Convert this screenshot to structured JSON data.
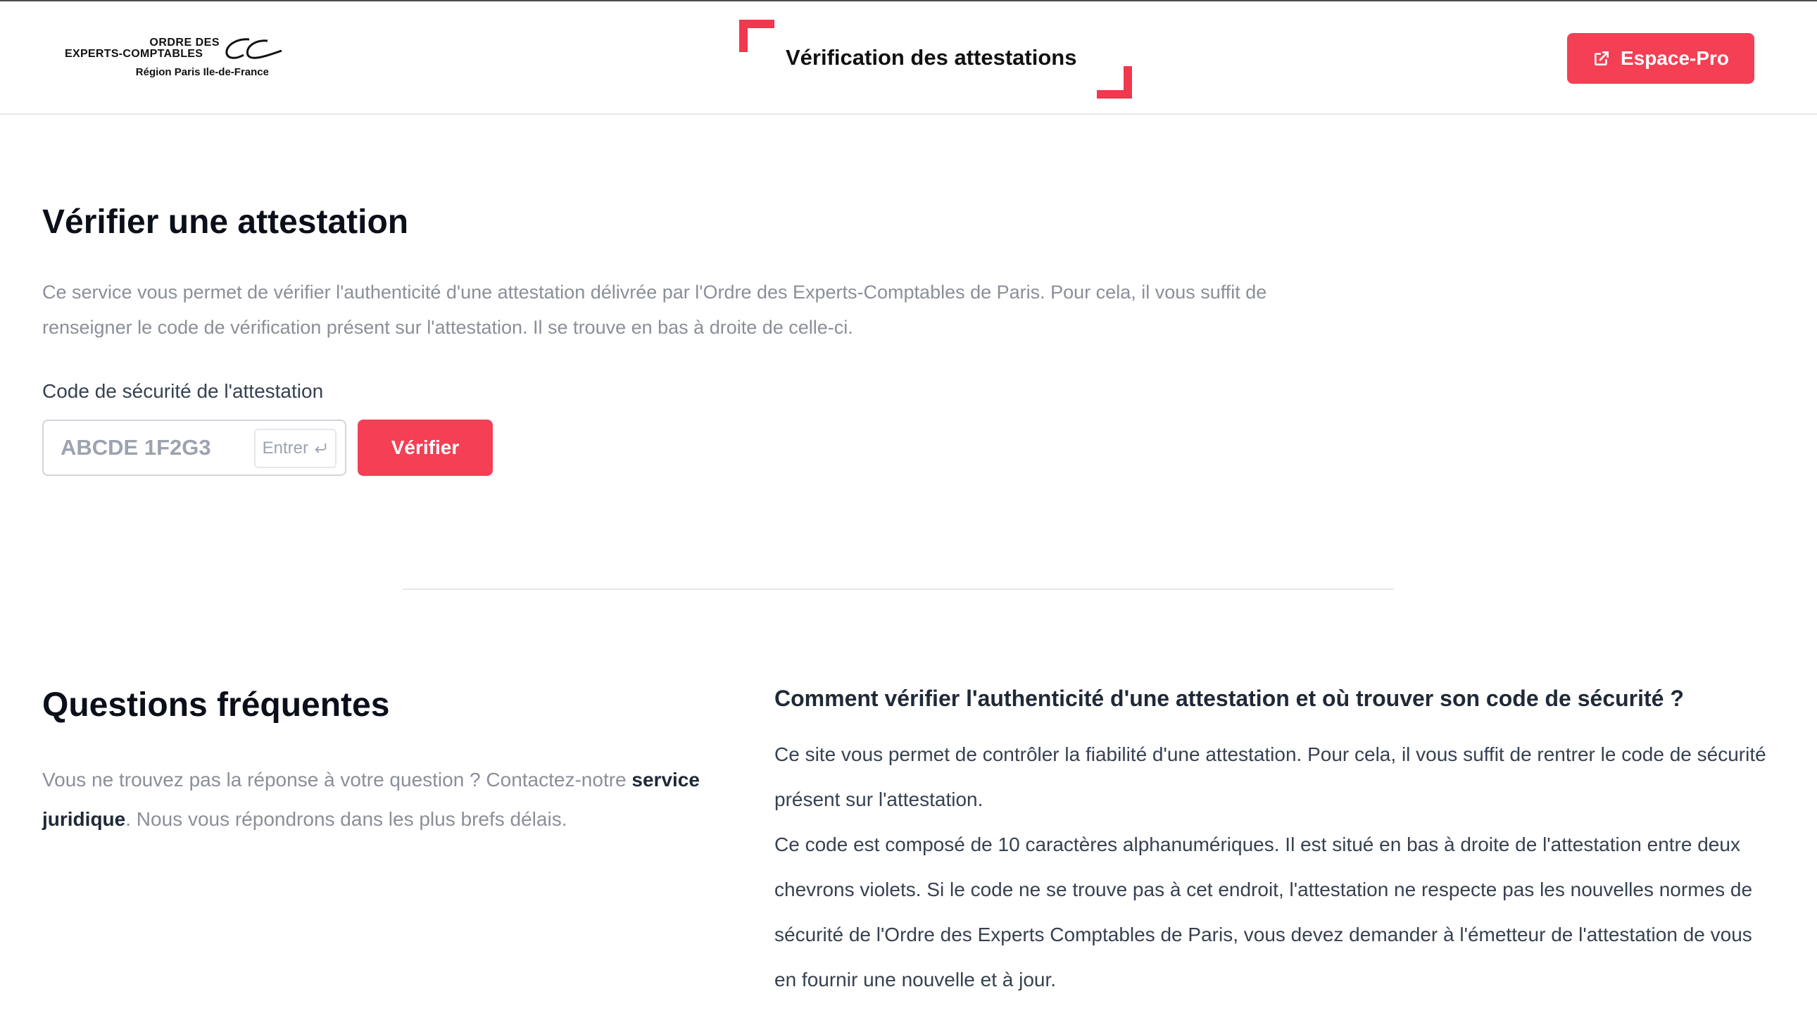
{
  "header": {
    "logo": {
      "line1": "ORDRE DES",
      "line2": "EXPERTS-COMPTABLES",
      "line3": "Région Paris Ile-de-France"
    },
    "title": "Vérification des attestations",
    "espace_pro_label": "Espace-Pro",
    "accent_color": "#f43f54"
  },
  "verify": {
    "title": "Vérifier une attestation",
    "description": "Ce service vous permet de vérifier l'authenticité d'une attestation délivrée par l'Ordre des Experts-Comptables de Paris. Pour cela, il vous suffit de renseigner le code de vérification présent sur l'attestation. Il se trouve en bas à droite de celle-ci.",
    "field_label": "Code de sécurité de l'attestation",
    "input_placeholder": "ABCDE 1F2G3",
    "input_value": "",
    "enter_hint": "Entrer",
    "button_label": "Vérifier"
  },
  "faq": {
    "title": "Questions fréquentes",
    "intro_before": "Vous ne trouvez pas la réponse à votre question ? Contactez-notre ",
    "intro_link": "service juridique",
    "intro_after": ". Nous vous répondrons dans les plus brefs délais.",
    "question": "Comment vérifier l'authenticité d'une attestation et où trouver son code de sécurité ?",
    "answer_p1": "Ce site vous permet de contrôler la fiabilité d'une attestation. Pour cela, il vous suffit de rentrer le code de sécurité présent sur l'attestation.",
    "answer_p2": "Ce code est composé de 10 caractères alphanumériques. Il est situé en bas à droite de l'attestation entre deux chevrons violets. Si le code ne se trouve pas à cet endroit, l'attestation ne respecte pas les nouvelles normes de sécurité de l'Ordre des Experts Comptables de Paris, vous devez demander à l'émetteur de l'attestation de vous en fournir une nouvelle et à jour."
  }
}
